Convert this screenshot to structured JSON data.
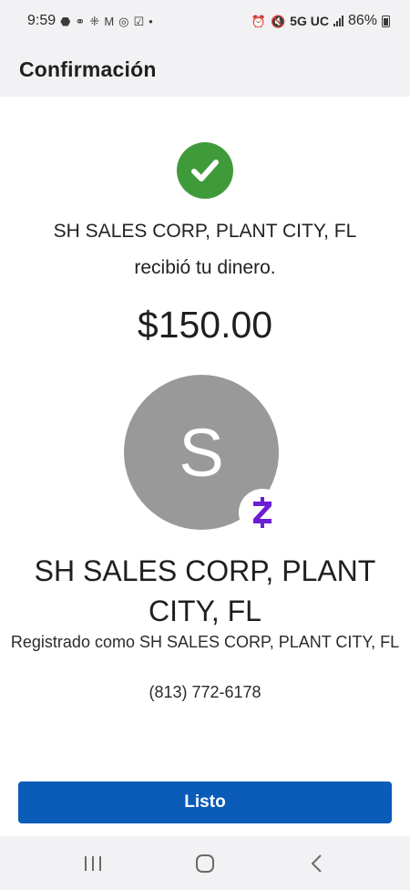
{
  "status_bar": {
    "time": "9:59",
    "network": "5G UC",
    "battery": "86%",
    "left_icons": [
      "chase-icon",
      "voicemail-icon",
      "apps-icon",
      "gmail-icon",
      "sync-icon",
      "check-icon",
      "dot-icon"
    ],
    "right_icons": [
      "alarm-icon",
      "mute-icon",
      "signal-icon",
      "battery-icon"
    ]
  },
  "header": {
    "title": "Confirmación"
  },
  "confirmation": {
    "recipient": "SH SALES CORP, PLANT CITY, FL",
    "received_text": "recibió tu dinero.",
    "amount": "$150.00"
  },
  "avatar": {
    "letter": "S",
    "badge": "zelle-icon",
    "badge_color": "#6d1ed4",
    "bg_color": "#999999"
  },
  "details": {
    "name": "SH SALES CORP, PLANT CITY, FL",
    "registered_as": "Registrado como SH SALES CORP, PLANT CITY, FL",
    "phone": "(813) 772-6178"
  },
  "actions": {
    "done_label": "Listo"
  },
  "colors": {
    "accent": "#0a5cb8",
    "success": "#3f9a3a"
  }
}
